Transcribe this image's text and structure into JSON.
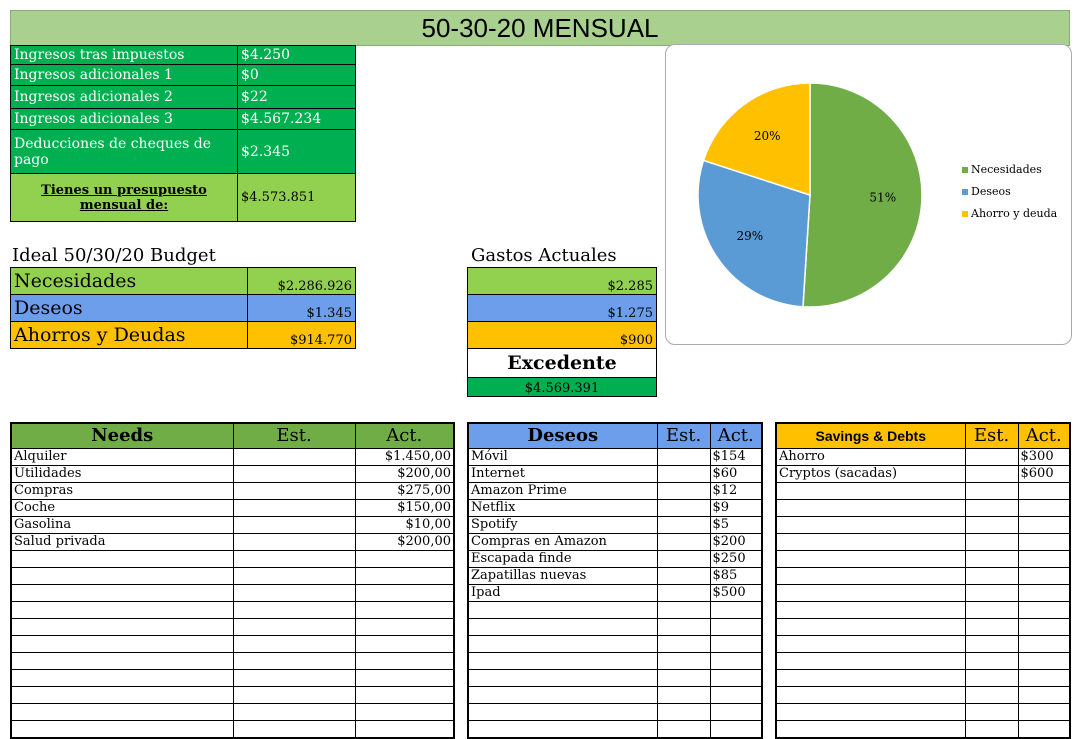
{
  "title": "50-30-20 MENSUAL",
  "income": [
    {
      "label": "Ingresos tras impuestos",
      "value": "$4.250"
    },
    {
      "label": "Ingresos adicionales 1",
      "value": "$0"
    },
    {
      "label": "Ingresos adicionales 2",
      "value": "$22"
    },
    {
      "label": "Ingresos adicionales 3",
      "value": "$4.567.234"
    },
    {
      "label": "Deducciones de cheques de pago",
      "value": "$2.345"
    }
  ],
  "total": {
    "label": "Tienes un presupuesto mensual de:",
    "value": "$4.573.851"
  },
  "ideal": {
    "heading": "Ideal 50/30/20 Budget",
    "rows": [
      {
        "label": "Necesidades",
        "value": "$2.286.926"
      },
      {
        "label": "Deseos",
        "value": "$1.345"
      },
      {
        "label": "Ahorros y Deudas",
        "value": "$914.770"
      }
    ]
  },
  "actual": {
    "heading": "Gastos Actuales",
    "values": [
      "$2.285",
      "$1.275",
      "$900"
    ],
    "surplus_label": "Excedente",
    "surplus_value": "$4.569.391"
  },
  "chart_data": {
    "type": "pie",
    "labels": [
      "Necesidades",
      "Deseos",
      "Ahorro y deuda"
    ],
    "values": [
      51,
      29,
      20
    ],
    "colors": [
      "#70ad47",
      "#5b9bd5",
      "#ffc000"
    ],
    "data_labels": [
      "51%",
      "29%",
      "20%"
    ],
    "legend": "right"
  },
  "needs": {
    "title": "Needs",
    "est": "Est.",
    "act": "Act.",
    "items": [
      {
        "name": "Alquiler",
        "act": "$1.450,00"
      },
      {
        "name": "Utilidades",
        "act": "$200,00"
      },
      {
        "name": "Compras",
        "act": "$275,00"
      },
      {
        "name": "Coche",
        "act": "$150,00"
      },
      {
        "name": "Gasolina",
        "act": "$10,00"
      },
      {
        "name": "Salud privada",
        "act": "$200,00"
      }
    ]
  },
  "deseos": {
    "title": "Deseos",
    "est": "Est.",
    "act": "Act.",
    "items": [
      {
        "name": "Móvil",
        "act": "$154"
      },
      {
        "name": "Internet",
        "act": "$60"
      },
      {
        "name": "Amazon Prime",
        "act": "$12"
      },
      {
        "name": "Netflix",
        "act": "$9"
      },
      {
        "name": "Spotify",
        "act": "$5"
      },
      {
        "name": "Compras en Amazon",
        "act": "$200"
      },
      {
        "name": "Escapada finde",
        "act": "$250"
      },
      {
        "name": "Zapatillas nuevas",
        "act": "$85"
      },
      {
        "name": "Ipad",
        "act": "$500"
      }
    ]
  },
  "savings": {
    "title": "Savings & Debts",
    "est": "Est.",
    "act": "Act.",
    "items": [
      {
        "name": "Ahorro",
        "act": "$300"
      },
      {
        "name": "Cryptos (sacadas)",
        "act": "$600"
      }
    ]
  }
}
